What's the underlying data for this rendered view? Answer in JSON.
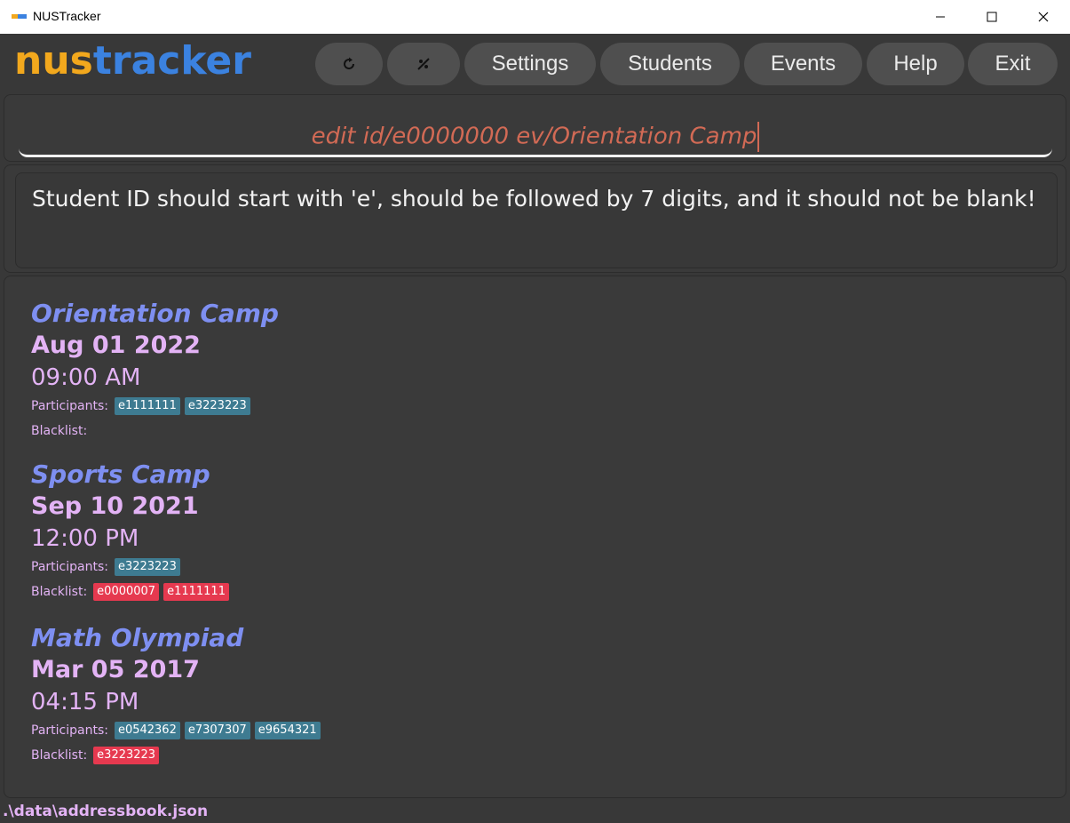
{
  "window": {
    "title": "NUSTracker"
  },
  "logo": {
    "part1": "nus",
    "part2": "tracker"
  },
  "toolbar": {
    "buttons": [
      {
        "icon": "refresh-icon"
      },
      {
        "icon": "theme-toggle-icon"
      },
      {
        "label": "Settings"
      },
      {
        "label": "Students"
      },
      {
        "label": "Events"
      },
      {
        "label": "Help"
      },
      {
        "label": "Exit"
      }
    ]
  },
  "command": {
    "value": "edit id/e0000000 ev/Orientation Camp"
  },
  "result": {
    "message": "Student ID should start with 'e', should be followed by 7 digits, and it should not be blank!"
  },
  "labels": {
    "participants": "Participants:",
    "blacklist": "Blacklist:"
  },
  "events": [
    {
      "name": "Orientation Camp",
      "date": "Aug 01 2022",
      "time": "09:00 AM",
      "participants": [
        "e1111111",
        "e3223223"
      ],
      "blacklist": []
    },
    {
      "name": "Sports Camp",
      "date": "Sep 10 2021",
      "time": "12:00 PM",
      "participants": [
        "e3223223"
      ],
      "blacklist": [
        "e0000007",
        "e1111111"
      ]
    },
    {
      "name": "Math Olympiad",
      "date": "Mar 05 2017",
      "time": "04:15 PM",
      "participants": [
        "e0542362",
        "e7307307",
        "e9654321"
      ],
      "blacklist": [
        "e3223223"
      ]
    }
  ],
  "status": {
    "path": ".\\data\\addressbook.json"
  },
  "colors": {
    "logo_primary": "#f2a81d",
    "logo_secondary": "#3b82e0",
    "event_name": "#7e8ff1",
    "event_date": "#e3b3f5",
    "participant_tag": "#3e7b91",
    "blacklist_tag": "#e6394f",
    "command_text": "#d26a55"
  }
}
